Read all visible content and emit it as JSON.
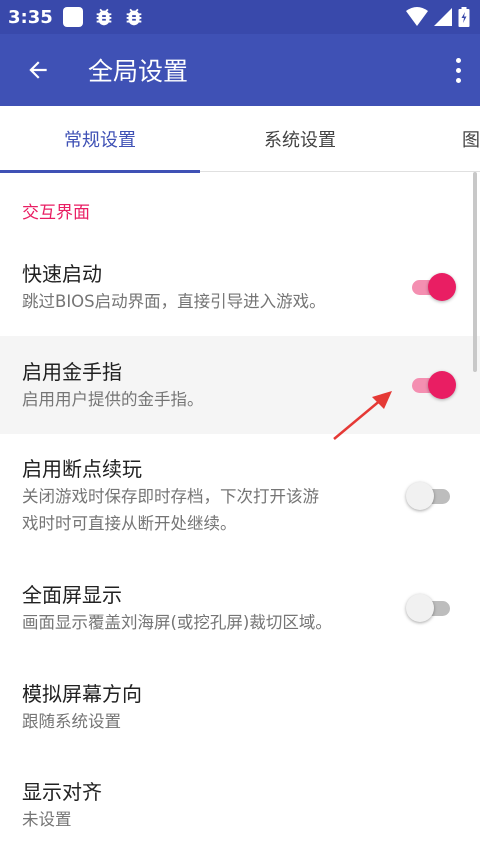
{
  "status_bar": {
    "time": "3:35"
  },
  "app_bar": {
    "title": "全局设置"
  },
  "tabs": [
    {
      "label": "常规设置"
    },
    {
      "label": "系统设置"
    },
    {
      "label": "图"
    }
  ],
  "section": {
    "title": "交互界面"
  },
  "settings": [
    {
      "title": "快速启动",
      "subtitle": "跳过BIOS启动界面，直接引导进入游戏。",
      "enabled": true
    },
    {
      "title": "启用金手指",
      "subtitle": "启用用户提供的金手指。",
      "enabled": true
    },
    {
      "title": "启用断点续玩",
      "subtitle_line1": "关闭游戏时保存即时存档，下次打开该游",
      "subtitle_line2": "戏时时可直接从断开处继续。",
      "enabled": false
    },
    {
      "title": "全面屏显示",
      "subtitle": "画面显示覆盖刘海屏(或挖孔屏)裁切区域。",
      "enabled": false
    },
    {
      "title": "模拟屏幕方向",
      "subtitle": "跟随系统设置"
    },
    {
      "title": "显示对齐",
      "subtitle": "未设置"
    }
  ],
  "colors": {
    "primary": "#3f51b5",
    "status_bar": "#3949ab",
    "accent": "#e91e63",
    "annotation_arrow": "#e53935"
  }
}
